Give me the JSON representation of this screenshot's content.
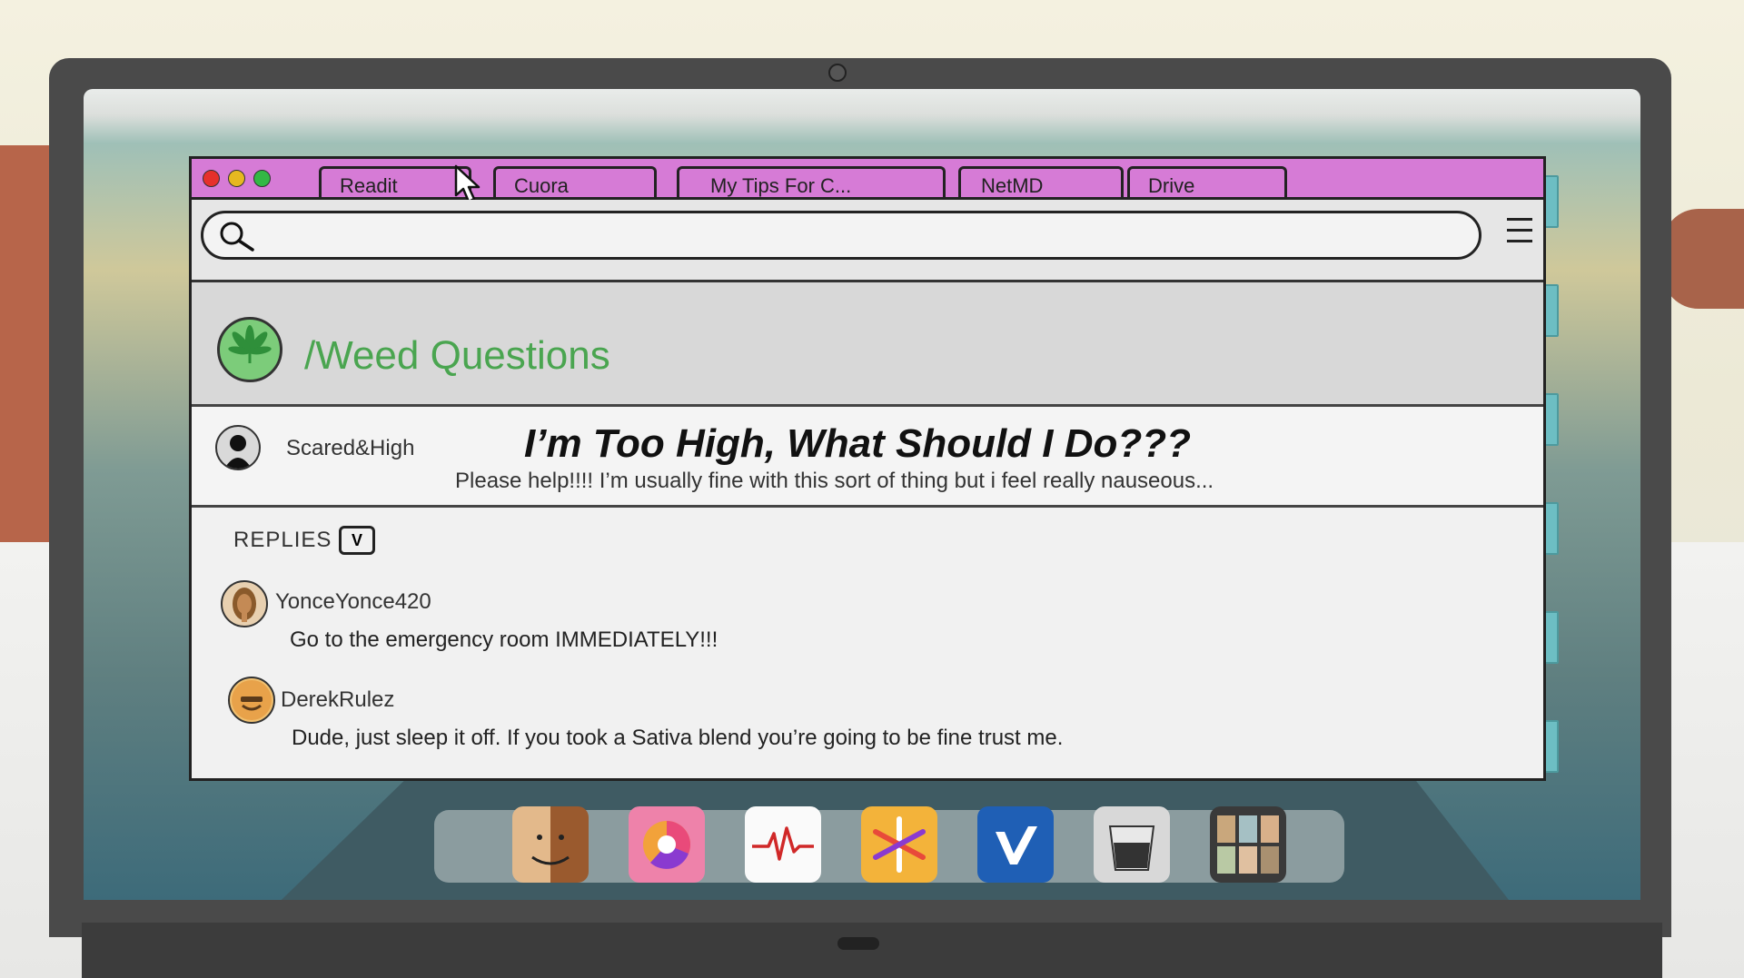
{
  "tabs": [
    {
      "label": "Readit"
    },
    {
      "label": "Cuora"
    },
    {
      "label": "My Tips For C..."
    },
    {
      "label": "NetMD"
    },
    {
      "label": "Drive"
    }
  ],
  "search": {
    "value": ""
  },
  "subreddit": {
    "title": "/Weed Questions"
  },
  "post": {
    "author": "Scared&High",
    "title": "I’m Too High, What Should I Do???",
    "body": "Please help!!!! I’m usually fine with this sort of thing but i feel really nauseous..."
  },
  "replies": {
    "label": "REPLIES",
    "toggle": "V",
    "items": [
      {
        "author": "YonceYonce420",
        "text": "Go to the emergency room IMMEDIATELY!!!"
      },
      {
        "author": "DerekRulez",
        "text": "Dude, just sleep it off. If you took a Sativa blend you’re going to be fine trust me."
      }
    ]
  },
  "dock": {
    "icons": [
      "finder-icon",
      "browser-icon",
      "health-icon",
      "photos-icon",
      "video-icon",
      "trash-icon",
      "gallery-icon"
    ]
  },
  "colors": {
    "tabbar": "#d67bd6",
    "accent_green": "#4aa550",
    "window_close": "#e6302b",
    "window_minimize": "#e6b820",
    "window_zoom": "#33b845"
  }
}
